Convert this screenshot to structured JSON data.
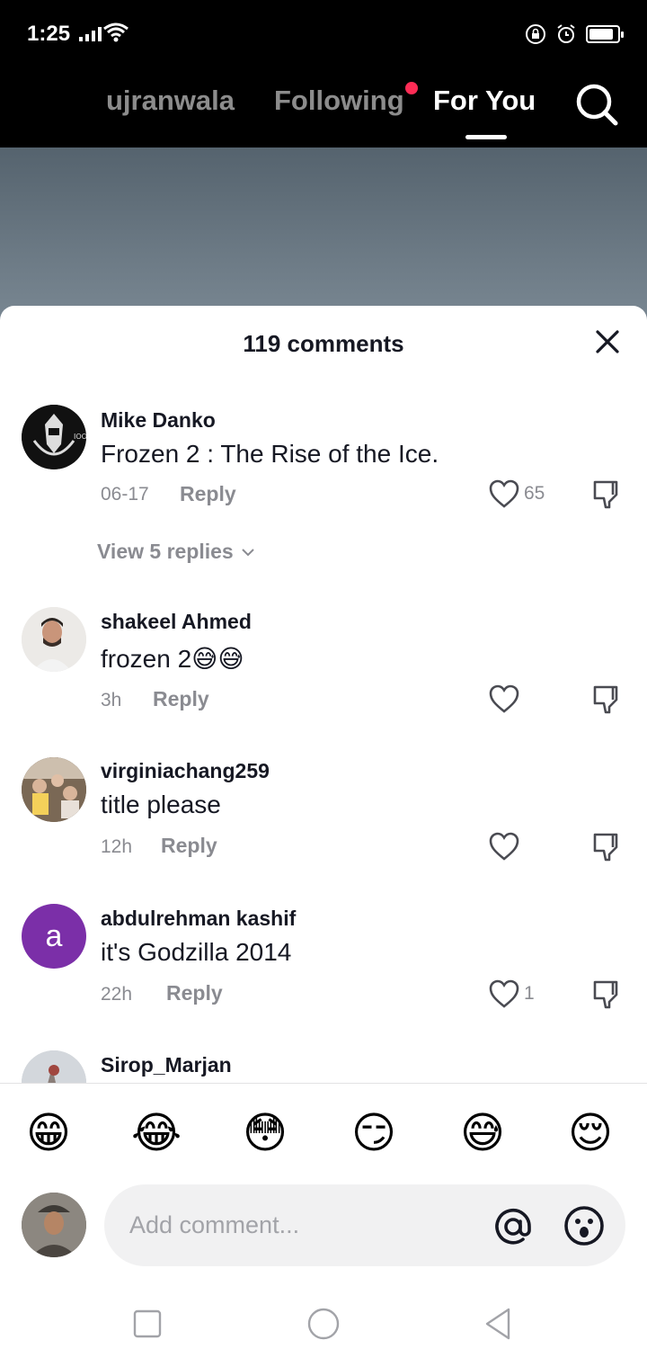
{
  "status_bar": {
    "time": "1:25"
  },
  "top_nav": {
    "tabs": [
      {
        "label": "ujranwala"
      },
      {
        "label": "Following"
      },
      {
        "label": "For You"
      }
    ],
    "following_has_dot": true,
    "active_tab": "For You"
  },
  "comments_sheet": {
    "title": "119 comments",
    "comments": [
      {
        "username": "Mike Danko",
        "text": "Frozen 2 : The Rise of the Ice.",
        "time": "06-17",
        "reply_label": "Reply",
        "likes": "65",
        "view_replies": "View 5 replies"
      },
      {
        "username": "shakeel Ahmed",
        "text": "frozen 2😅😅",
        "time": "3h",
        "reply_label": "Reply",
        "likes": ""
      },
      {
        "username": "virginiachang259",
        "text": "title please",
        "time": "12h",
        "reply_label": "Reply",
        "likes": ""
      },
      {
        "username": "abdulrehman kashif",
        "text": "it's Godzilla 2014",
        "time": "22h",
        "reply_label": "Reply",
        "likes": "1",
        "avatar_letter": "a"
      },
      {
        "username": "Sirop_Marjan"
      }
    ]
  },
  "emoji_bar": [
    "😁",
    "😂",
    "😳",
    "😏",
    "😅",
    "😌"
  ],
  "composer": {
    "placeholder": "Add comment..."
  },
  "colors": {
    "accent_dot": "#fe2c55",
    "avatar_purple": "#7b2fa8"
  }
}
